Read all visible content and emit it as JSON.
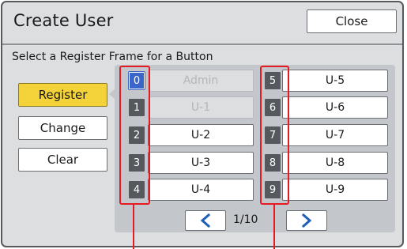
{
  "header": {
    "title": "Create User",
    "close_label": "Close"
  },
  "instruction": "Select a Register Frame for a Button",
  "side_buttons": [
    {
      "label": "Register",
      "active": true
    },
    {
      "label": "Change",
      "active": false
    },
    {
      "label": "Clear",
      "active": false
    }
  ],
  "slots_left": [
    {
      "num": "0",
      "label": "Admin",
      "disabled": true,
      "selected": true
    },
    {
      "num": "1",
      "label": "U-1",
      "disabled": true,
      "selected": false
    },
    {
      "num": "2",
      "label": "U-2",
      "disabled": false,
      "selected": false
    },
    {
      "num": "3",
      "label": "U-3",
      "disabled": false,
      "selected": false
    },
    {
      "num": "4",
      "label": "U-4",
      "disabled": false,
      "selected": false
    }
  ],
  "slots_right": [
    {
      "num": "5",
      "label": "U-5",
      "disabled": false,
      "selected": false
    },
    {
      "num": "6",
      "label": "U-6",
      "disabled": false,
      "selected": false
    },
    {
      "num": "7",
      "label": "U-7",
      "disabled": false,
      "selected": false
    },
    {
      "num": "8",
      "label": "U-8",
      "disabled": false,
      "selected": false
    },
    {
      "num": "9",
      "label": "U-9",
      "disabled": false,
      "selected": false
    }
  ],
  "pager": {
    "page": "1/10",
    "prev_icon": "chevron-left-icon",
    "next_icon": "chevron-right-icon"
  },
  "colors": {
    "highlight": "#e41b23",
    "accent": "#f3d23a",
    "selected_number": "#3a66c9",
    "arrow": "#1f5fb8"
  }
}
